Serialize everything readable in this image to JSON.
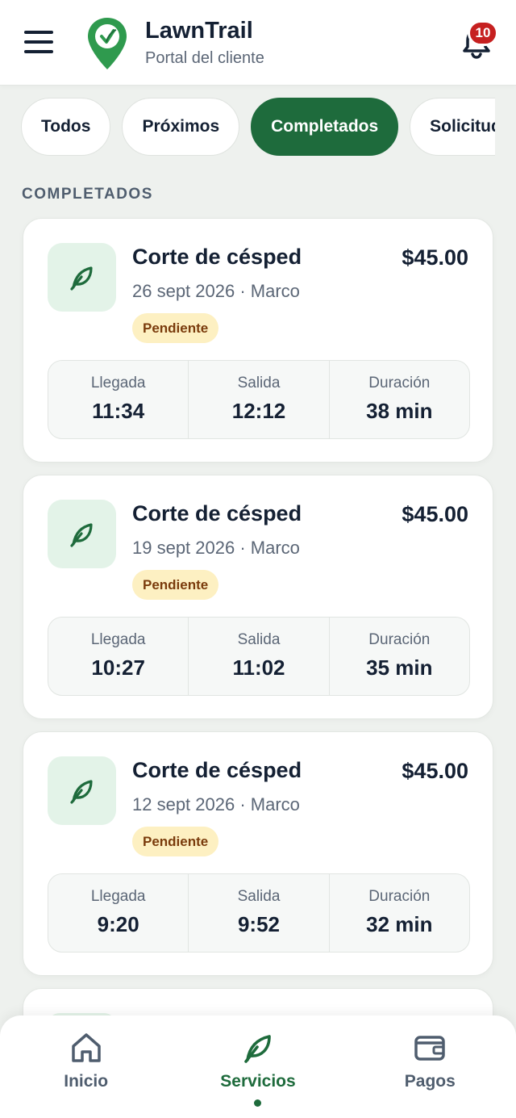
{
  "header": {
    "title": "LawnTrail",
    "subtitle": "Portal del cliente",
    "notification_count": "10"
  },
  "tabs": [
    {
      "label": "Todos",
      "active": false
    },
    {
      "label": "Próximos",
      "active": false
    },
    {
      "label": "Completados",
      "active": true
    },
    {
      "label": "Solicitudes",
      "active": false
    }
  ],
  "section_label": "COMPLETADOS",
  "labels": {
    "arrival": "Llegada",
    "departure": "Salida",
    "duration": "Duración"
  },
  "services": [
    {
      "name": "Corte de césped",
      "price": "$45.00",
      "meta": "26 sept 2026 · Marco",
      "status": "Pendiente",
      "arrival": "11:34",
      "departure": "12:12",
      "duration": "38 min"
    },
    {
      "name": "Corte de césped",
      "price": "$45.00",
      "meta": "19 sept 2026 · Marco",
      "status": "Pendiente",
      "arrival": "10:27",
      "departure": "11:02",
      "duration": "35 min"
    },
    {
      "name": "Corte de césped",
      "price": "$45.00",
      "meta": "12 sept 2026 · Marco",
      "status": "Pendiente",
      "arrival": "9:20",
      "departure": "9:52",
      "duration": "32 min"
    }
  ],
  "nav": [
    {
      "label": "Inicio",
      "icon": "home-icon",
      "active": false
    },
    {
      "label": "Servicios",
      "icon": "leaf-icon",
      "active": true
    },
    {
      "label": "Pagos",
      "icon": "wallet-icon",
      "active": false
    }
  ],
  "colors": {
    "brand": "#1e6b3c",
    "badge": "#c62020",
    "status_bg": "#fdf0c2",
    "status_text": "#7a3b0c"
  }
}
